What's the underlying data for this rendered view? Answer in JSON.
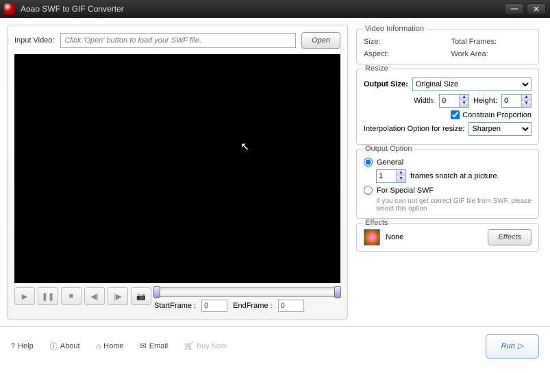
{
  "app": {
    "title": "Aoao SWF to GIF Converter"
  },
  "input": {
    "label": "Input Video:",
    "placeholder": "Click 'Open' button to load your SWF file.",
    "open": "Open"
  },
  "frames": {
    "startLabel": "StartFrame :",
    "start": "0",
    "endLabel": "EndFrame :",
    "end": "0"
  },
  "videoInfo": {
    "legend": "Video Information",
    "sizeLabel": "Size:",
    "totalFramesLabel": "Total Frames:",
    "aspectLabel": "Aspect:",
    "workAreaLabel": "Work Area:"
  },
  "resize": {
    "legend": "Resize",
    "outputSizeLabel": "Output Size:",
    "outputSize": "Original Size",
    "widthLabel": "Width:",
    "width": "0",
    "heightLabel": "Height:",
    "height": "0",
    "constrain": "Constrain Proportion",
    "interpLabel": "Interpolation Option for resize:",
    "interp": "Sharpen"
  },
  "output": {
    "legend": "Output Option",
    "general": "General",
    "framesVal": "1",
    "framesText": "frames snatch at a picture.",
    "special": "For Special SWF",
    "specialHint": "If you can not get correct GIF file from SWF, please select this option"
  },
  "effects": {
    "legend": "Effects",
    "value": "None",
    "btn": "Effects"
  },
  "footer": {
    "help": "Help",
    "about": "About",
    "home": "Home",
    "email": "Email",
    "buy": "Buy Now",
    "run": "Run"
  }
}
